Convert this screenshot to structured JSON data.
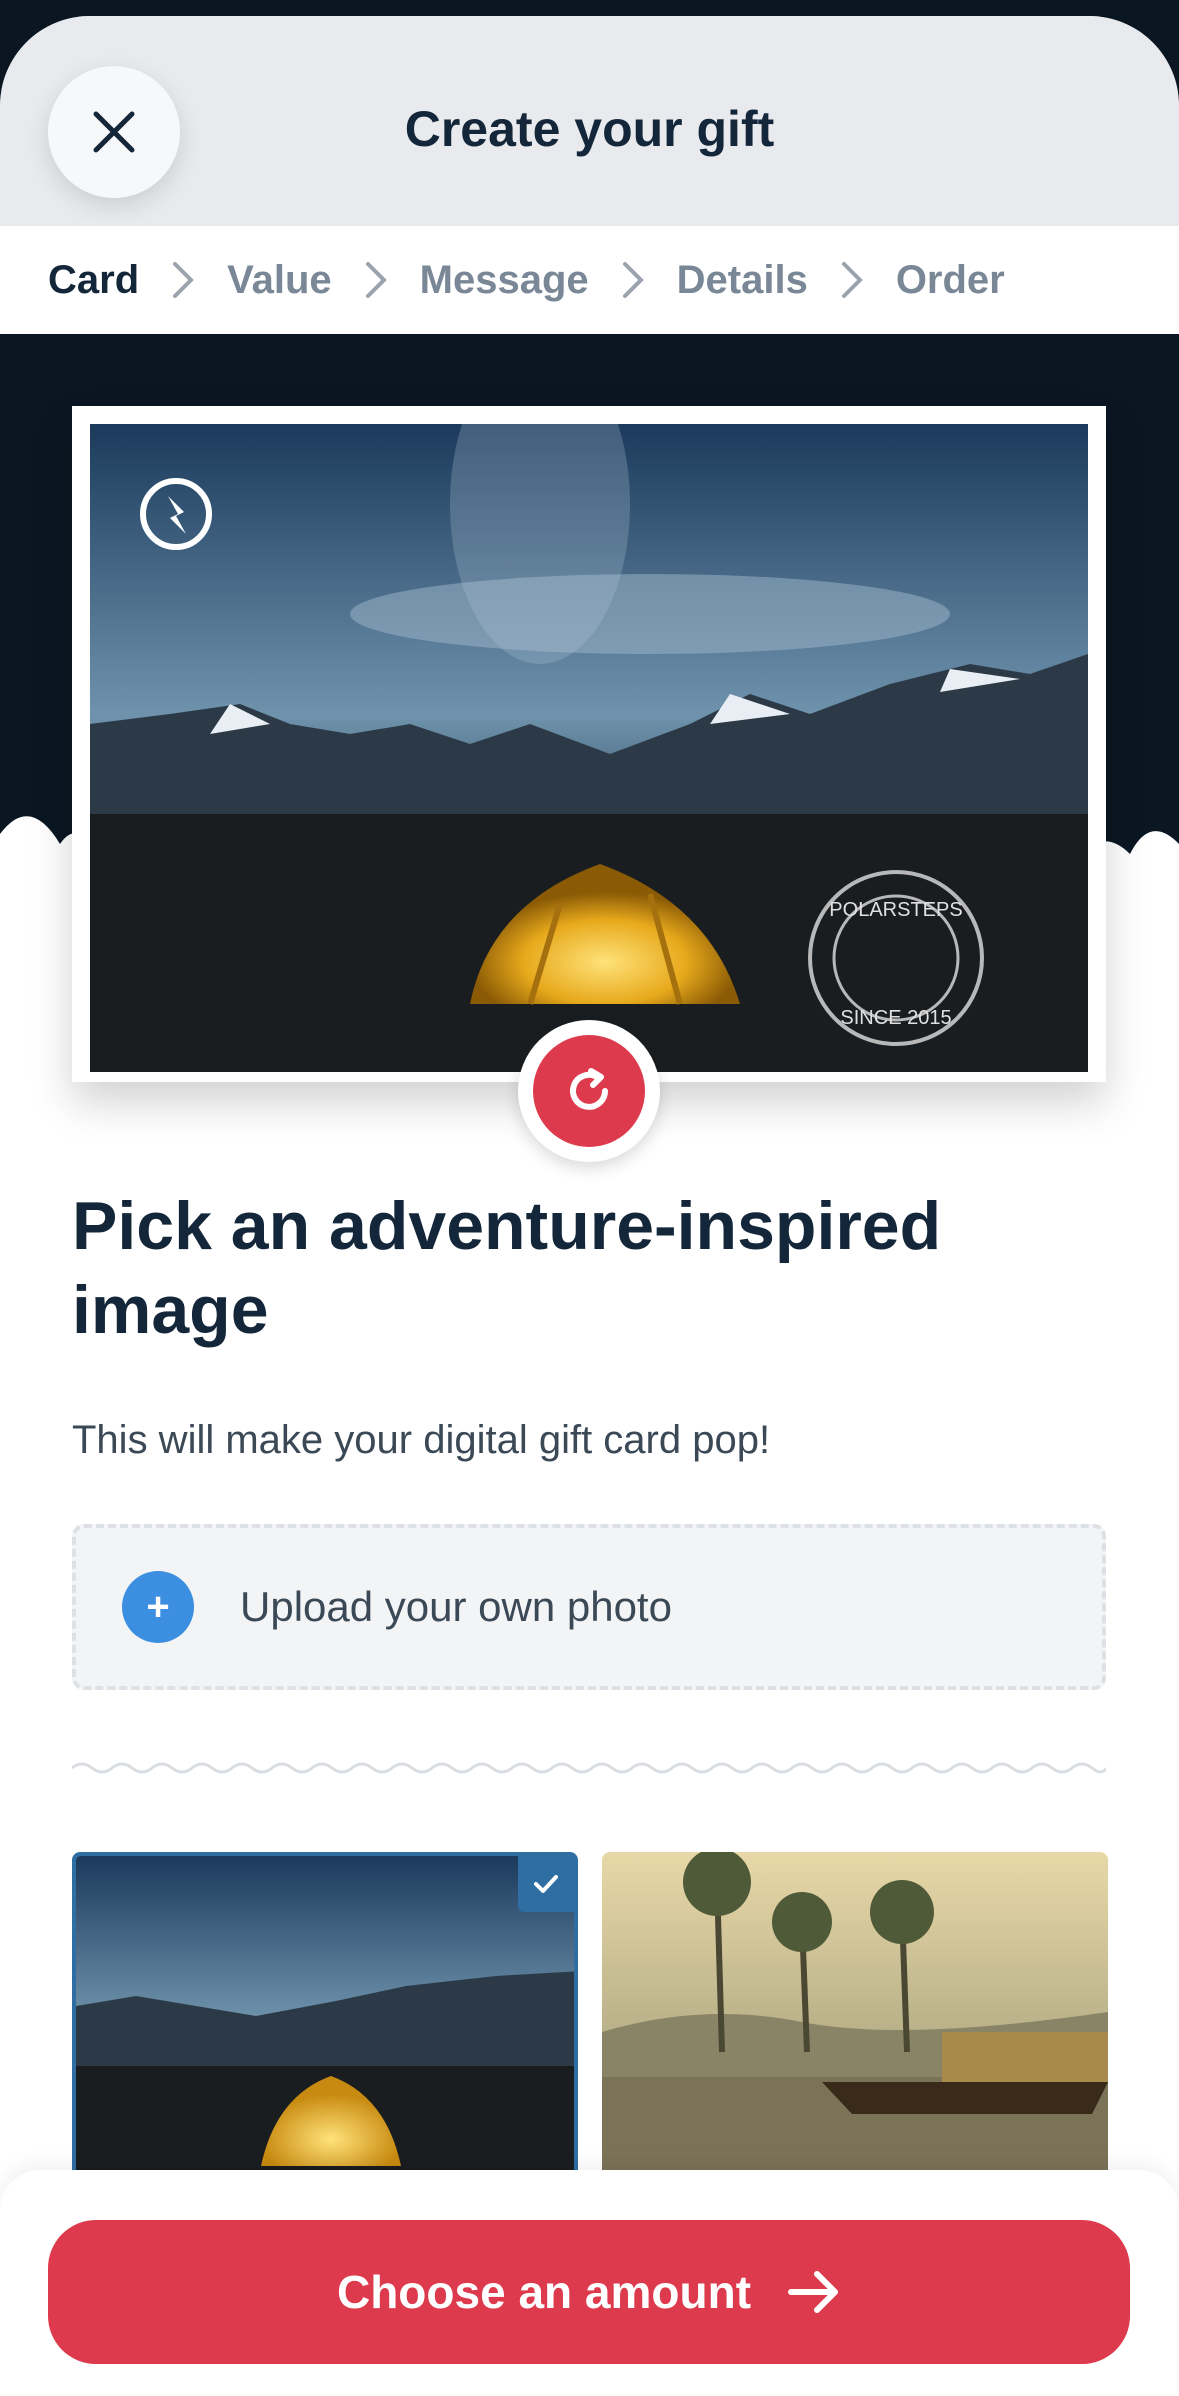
{
  "header": {
    "title": "Create your gift",
    "close_icon": "close-icon"
  },
  "steps": [
    {
      "label": "Card",
      "active": true
    },
    {
      "label": "Value",
      "active": false
    },
    {
      "label": "Message",
      "active": false
    },
    {
      "label": "Details",
      "active": false
    },
    {
      "label": "Order",
      "active": false
    }
  ],
  "card_preview": {
    "stamp_text_top": "POLARSTEPS",
    "stamp_text_bottom": "SINCE 2015",
    "refresh_icon": "refresh-icon"
  },
  "content": {
    "heading": "Pick an adventure-inspired image",
    "subtitle": "This will make your digital gift card pop!",
    "upload_label": "Upload your own photo",
    "upload_icon": "+"
  },
  "gallery": [
    {
      "name": "night-tent-mountains",
      "selected": true
    },
    {
      "name": "backwaters-houseboat",
      "selected": false
    }
  ],
  "footer": {
    "cta_label": "Choose an amount",
    "cta_icon": "arrow-right-icon"
  },
  "colors": {
    "accent": "#de3a4d",
    "navy": "#14263a",
    "blue": "#3b8ee0",
    "selected_border": "#2e6ea3"
  }
}
